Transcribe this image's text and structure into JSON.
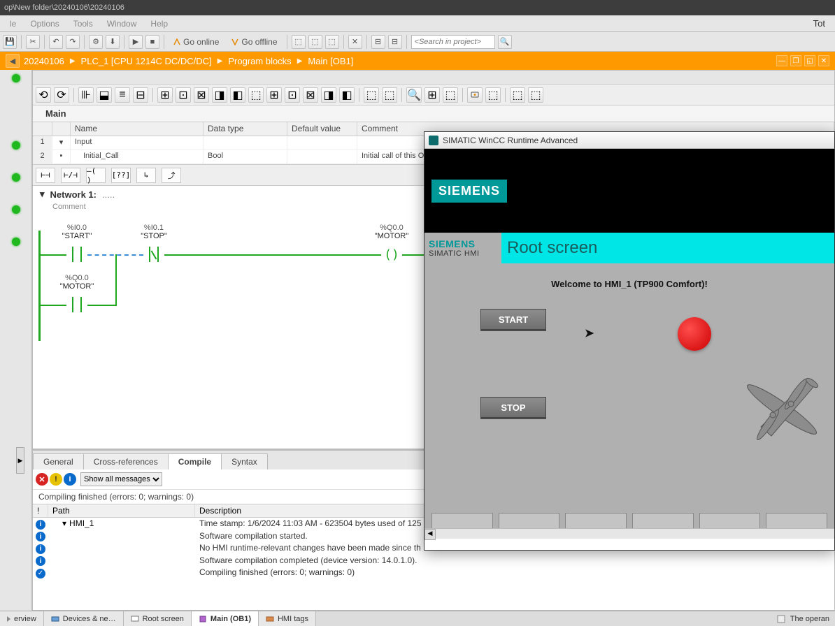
{
  "title_path": "op\\New folder\\20240106\\20240106",
  "menu": {
    "items": [
      "le",
      "Options",
      "Tools",
      "Window",
      "Help"
    ],
    "right": "Tot"
  },
  "toolbar": {
    "go_online": "Go online",
    "go_offline": "Go offline",
    "search_placeholder": "<Search in project>"
  },
  "breadcrumb": [
    "20240106",
    "PLC_1 [CPU 1214C DC/DC/DC]",
    "Program blocks",
    "Main [OB1]"
  ],
  "block": {
    "name": "Main"
  },
  "interface": {
    "headers": {
      "name": "Name",
      "dtype": "Data type",
      "def": "Default value",
      "comment": "Comment"
    },
    "rows": [
      {
        "num": "1",
        "name": "Input",
        "dtype": "",
        "def": "",
        "comment": ""
      },
      {
        "num": "2",
        "name": "Initial_Call",
        "dtype": "Bool",
        "def": "",
        "comment": "Initial call of this O"
      }
    ]
  },
  "network": {
    "title": "Network 1:",
    "comment": "Comment",
    "tags": {
      "start": {
        "addr": "%I0.0",
        "name": "\"START\""
      },
      "stop": {
        "addr": "%I0.1",
        "name": "\"STOP\""
      },
      "motor_coil": {
        "addr": "%Q0.0",
        "name": "\"MOTOR\""
      },
      "motor_hold": {
        "addr": "%Q0.0",
        "name": "\"MOTOR\""
      }
    }
  },
  "bottom_panel": {
    "tabs": {
      "general": "General",
      "xref": "Cross-references",
      "compile": "Compile",
      "syntax": "Syntax"
    },
    "filter": "Show all messages",
    "summary": "Compiling finished (errors: 0; warnings: 0)",
    "headers": {
      "ex": "!",
      "path": "Path",
      "desc": "Description"
    },
    "rows": [
      {
        "icon": "info",
        "path": "HMI_1",
        "desc": "Time stamp: 1/6/2024 11:03 AM - 623504 bytes used of 125"
      },
      {
        "icon": "info",
        "path": "",
        "desc": "Software compilation started."
      },
      {
        "icon": "info",
        "path": "",
        "desc": "No HMI runtime-relevant changes have been made since th"
      },
      {
        "icon": "info",
        "path": "",
        "desc": "Software compilation completed (device version: 14.0.1.0)."
      },
      {
        "icon": "check",
        "path": "",
        "desc": "Compiling finished (errors: 0; warnings: 0)"
      }
    ]
  },
  "hmi": {
    "window_title": "SIMATIC WinCC Runtime Advanced",
    "logo": "SIEMENS",
    "brand": "SIEMENS",
    "brand_sub": "SIMATIC HMI",
    "root_title": "Root screen",
    "welcome": "Welcome to HMI_1 (TP900 Comfort)!",
    "start_btn": "START",
    "stop_btn": "STOP"
  },
  "task_tabs": {
    "overview": "erview",
    "devices": "Devices & ne…",
    "root": "Root screen",
    "main": "Main (OB1)",
    "tags": "HMI tags",
    "right": "The operan"
  }
}
